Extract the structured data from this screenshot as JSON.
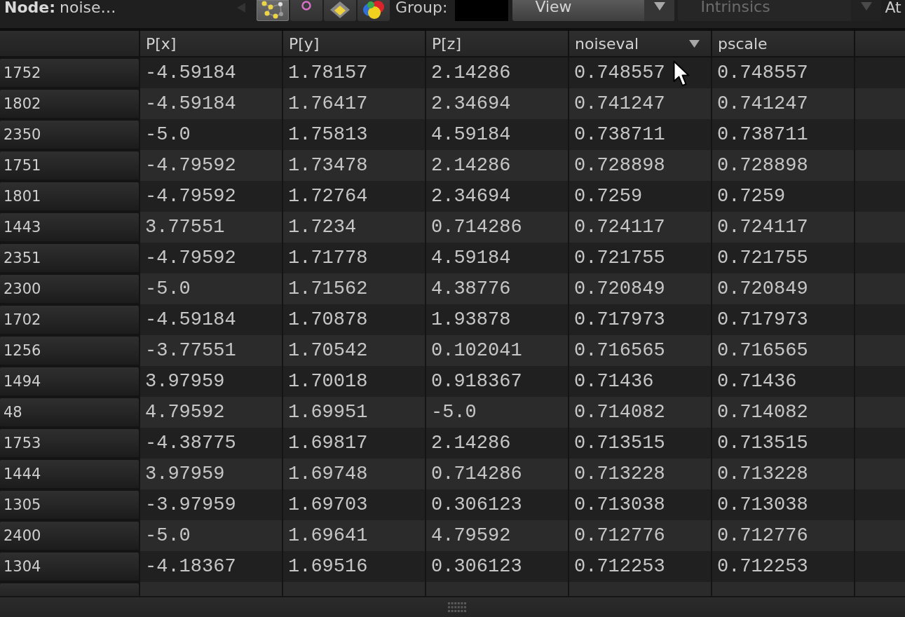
{
  "toolbar": {
    "node_label": "Node:",
    "node_name": "noise…",
    "view_buttons": [
      {
        "kind": "graph",
        "selected": true
      },
      {
        "kind": "ring",
        "selected": false
      },
      {
        "kind": "diamond",
        "selected": false
      },
      {
        "kind": "spheres",
        "selected": false
      }
    ],
    "group_label": "Group:",
    "view_menu": {
      "value": "View",
      "disabled": false
    },
    "attribute_menu": {
      "value": "Intrinsics",
      "disabled": true
    },
    "edge_label": "At"
  },
  "table": {
    "columns": [
      {
        "label": "P[x]",
        "sorted": false
      },
      {
        "label": "P[y]",
        "sorted": false
      },
      {
        "label": "P[z]",
        "sorted": false
      },
      {
        "label": "noiseval",
        "sorted": true
      },
      {
        "label": "pscale",
        "sorted": false
      }
    ],
    "rows": [
      {
        "id": "1752",
        "values": [
          "-4.59184",
          "1.78157",
          "2.14286",
          "0.748557",
          "0.748557"
        ]
      },
      {
        "id": "1802",
        "values": [
          "-4.59184",
          "1.76417",
          "2.34694",
          "0.741247",
          "0.741247"
        ]
      },
      {
        "id": "2350",
        "values": [
          "-5.0",
          "1.75813",
          "4.59184",
          "0.738711",
          "0.738711"
        ]
      },
      {
        "id": "1751",
        "values": [
          "-4.79592",
          "1.73478",
          "2.14286",
          "0.728898",
          "0.728898"
        ]
      },
      {
        "id": "1801",
        "values": [
          "-4.79592",
          "1.72764",
          "2.34694",
          "0.7259",
          "0.7259"
        ]
      },
      {
        "id": "1443",
        "values": [
          "3.77551",
          "1.7234",
          "0.714286",
          "0.724117",
          "0.724117"
        ]
      },
      {
        "id": "2351",
        "values": [
          "-4.79592",
          "1.71778",
          "4.59184",
          "0.721755",
          "0.721755"
        ]
      },
      {
        "id": "2300",
        "values": [
          "-5.0",
          "1.71562",
          "4.38776",
          "0.720849",
          "0.720849"
        ]
      },
      {
        "id": "1702",
        "values": [
          "-4.59184",
          "1.70878",
          "1.93878",
          "0.717973",
          "0.717973"
        ]
      },
      {
        "id": "1256",
        "values": [
          "-3.77551",
          "1.70542",
          "0.102041",
          "0.716565",
          "0.716565"
        ]
      },
      {
        "id": "1494",
        "values": [
          "3.97959",
          "1.70018",
          "0.918367",
          "0.71436",
          "0.71436"
        ]
      },
      {
        "id": "48",
        "values": [
          "4.79592",
          "1.69951",
          "-5.0",
          "0.714082",
          "0.714082"
        ]
      },
      {
        "id": "1753",
        "values": [
          "-4.38775",
          "1.69817",
          "2.14286",
          "0.713515",
          "0.713515"
        ]
      },
      {
        "id": "1444",
        "values": [
          "3.97959",
          "1.69748",
          "0.714286",
          "0.713228",
          "0.713228"
        ]
      },
      {
        "id": "1305",
        "values": [
          "-3.97959",
          "1.69703",
          "0.306123",
          "0.713038",
          "0.713038"
        ]
      },
      {
        "id": "2400",
        "values": [
          "-5.0",
          "1.69641",
          "4.79592",
          "0.712776",
          "0.712776"
        ]
      },
      {
        "id": "1304",
        "values": [
          "-4.18367",
          "1.69516",
          "0.306123",
          "0.712253",
          "0.712253"
        ]
      }
    ]
  }
}
